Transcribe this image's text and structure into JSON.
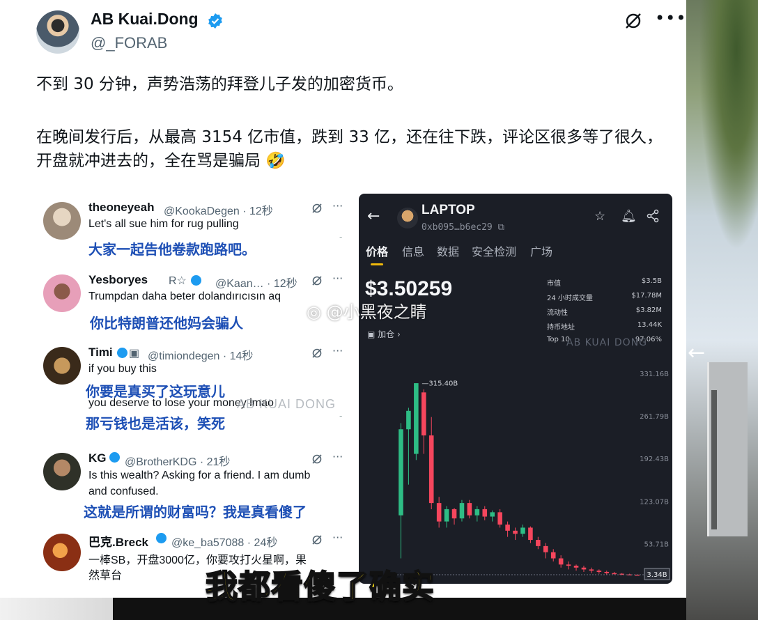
{
  "tweet": {
    "author_name": "AB Kuai.Dong",
    "author_handle": "@_FORAB",
    "text_1": "不到 30 分钟，声势浩荡的拜登儿子发的加密货币。",
    "text_2": "在晚间发行后，从最高 3154 亿市值，跌到 33 亿，还在往下跌，评论区很多等了很久，开盘就冲进去的，全在骂是骗局 🤣"
  },
  "replies": [
    {
      "name": "theoneyeah",
      "meta": "@KookaDegen · 12秒",
      "text": "Let's all sue him for rug pulling",
      "cn": "大家一起告他卷款跑路吧。",
      "avatar_color": "#b8a99a"
    },
    {
      "name": "Yesboryes",
      "meta": "@Kaan… · 12秒",
      "text": "Trumpdan daha beter dolandırıcısın aq",
      "cn": "你比特朗普还他妈会骗人",
      "avatar_color": "#d99ab0"
    },
    {
      "name": "Timi",
      "meta": "@timiondegen · 14秒",
      "text": "if you buy this",
      "cn": "你要是真买了这玩意儿",
      "text_2": "you deserve to lose your money lmao",
      "cn_2": "那亏钱也是活该，笑死",
      "avatar_color": "#8a5a2a"
    },
    {
      "name": "KG",
      "meta": "@BrotherKDG · 21秒",
      "text": "Is this wealth? Asking for a friend. I am dumb",
      "text_2": "and confused.",
      "cn": "这就是所谓的财富吗？我是真看傻了",
      "avatar_color": "#5a5a4a"
    },
    {
      "name": "巴克.Breck",
      "meta": "@ke_ba57088 · 24秒",
      "text": "一棒SB，开盘3000亿，你要攻打火星啊，果",
      "text_2": "然草台",
      "avatar_color": "#c0562a"
    }
  ],
  "crypto": {
    "title": "LAPTOP",
    "address": "0xb095…b6ec29",
    "tabs": [
      "价格",
      "信息",
      "数据",
      "安全检测",
      "广场"
    ],
    "price": "$3.50259",
    "stats": [
      {
        "k": "市值",
        "v": "$3.5B"
      },
      {
        "k": "24 小时成交量",
        "v": "$17.78M"
      },
      {
        "k": "流动性",
        "v": "$3.82M"
      },
      {
        "k": "持币地址",
        "v": "13.44K"
      },
      {
        "k": "Top 10",
        "v": "97.06%"
      }
    ],
    "join": "加仓",
    "watermark": "AB KUAI DONG"
  },
  "chart_data": {
    "type": "candlestick",
    "y_ticks": [
      "331.16B",
      "261.79B",
      "192.43B",
      "123.07B",
      "53.71B"
    ],
    "peak_label": "315.40B",
    "last_label": "3.34B",
    "ylim": [
      0,
      340
    ],
    "candles": [
      [
        100,
        240,
        30,
        250
      ],
      [
        240,
        270,
        150,
        275
      ],
      [
        200,
        315,
        190,
        315
      ],
      [
        300,
        230,
        200,
        305
      ],
      [
        230,
        120,
        110,
        260
      ],
      [
        120,
        90,
        80,
        130
      ],
      [
        90,
        110,
        80,
        115
      ],
      [
        110,
        95,
        85,
        112
      ],
      [
        95,
        120,
        90,
        125
      ],
      [
        120,
        100,
        95,
        125
      ],
      [
        100,
        110,
        90,
        115
      ],
      [
        110,
        98,
        92,
        115
      ],
      [
        98,
        105,
        90,
        108
      ],
      [
        105,
        85,
        80,
        110
      ],
      [
        85,
        75,
        65,
        90
      ],
      [
        75,
        70,
        60,
        80
      ],
      [
        70,
        80,
        65,
        85
      ],
      [
        80,
        60,
        55,
        82
      ],
      [
        60,
        50,
        45,
        65
      ],
      [
        50,
        40,
        30,
        55
      ],
      [
        40,
        30,
        25,
        45
      ],
      [
        30,
        20,
        15,
        35
      ],
      [
        20,
        18,
        12,
        25
      ],
      [
        18,
        15,
        10,
        20
      ],
      [
        15,
        12,
        8,
        18
      ],
      [
        12,
        10,
        6,
        15
      ],
      [
        10,
        8,
        5,
        12
      ],
      [
        8,
        6,
        4,
        10
      ],
      [
        6,
        5,
        4,
        8
      ],
      [
        5,
        4,
        3,
        6
      ],
      [
        4,
        3.5,
        3,
        5
      ],
      [
        3.5,
        3.3,
        3,
        4
      ]
    ]
  },
  "overlay": {
    "weibo_watermark": "@小黑夜之睛",
    "ab_watermark": "AB KUAI DONG",
    "subtitle": "我都看傻了确实"
  }
}
